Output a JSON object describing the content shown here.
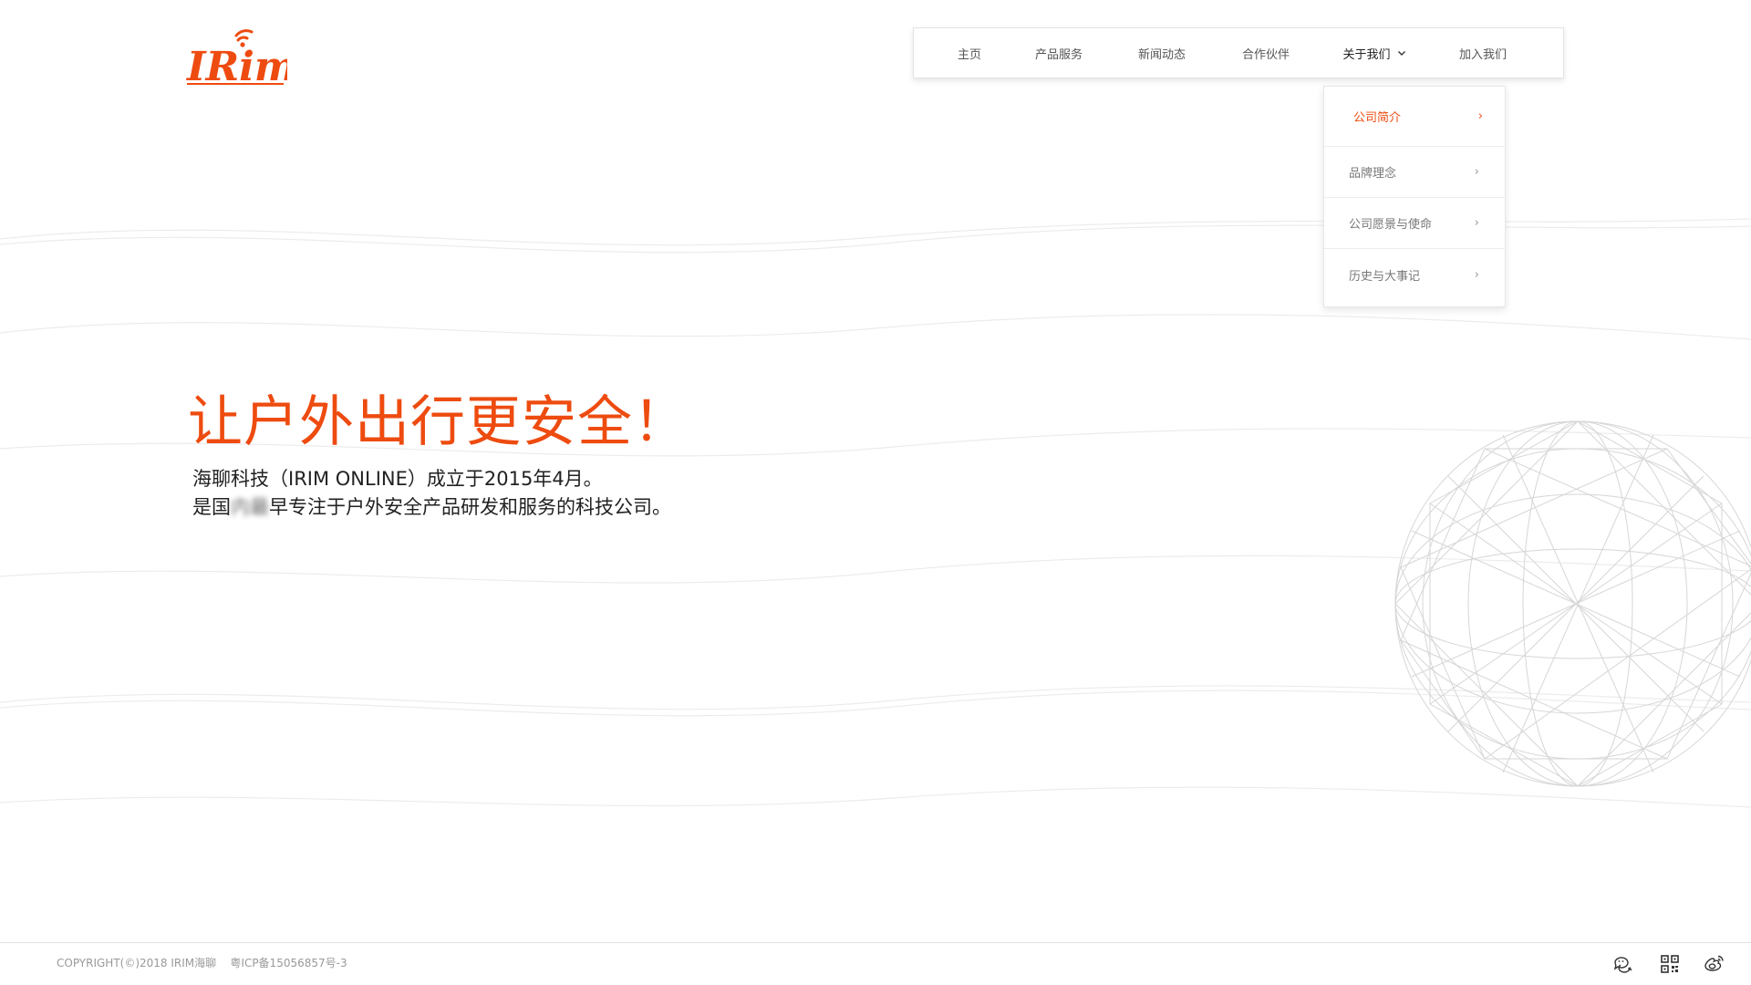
{
  "brand": {
    "logo_text": "IRim",
    "accent": "#ee4b10"
  },
  "nav": {
    "items": [
      {
        "label": "主页"
      },
      {
        "label": "产品服务"
      },
      {
        "label": "新闻动态"
      },
      {
        "label": "合作伙伴"
      },
      {
        "label": "关于我们",
        "has_dropdown": true,
        "icon": "chevron-down-icon"
      },
      {
        "label": "加入我们"
      }
    ]
  },
  "dropdown": {
    "items": [
      {
        "label": "公司简介",
        "arrow": "›",
        "selected": true
      },
      {
        "label": "品牌理念",
        "arrow": "›"
      },
      {
        "label": "公司愿景与使命",
        "arrow": "›"
      },
      {
        "label": "历史与大事记",
        "arrow": "›"
      }
    ]
  },
  "hero": {
    "title": "让户外出行更安全！",
    "line1": "海聊科技（IRIM ONLINE）成立于2015年4月。",
    "line2_prefix": "是国",
    "line2_blurred": "内最",
    "line2_suffix": "早专注于户外安全产品研发和服务的科技公司。"
  },
  "footer": {
    "copyright": "COPYRIGHT(©)2018 IRIM海聊    粤ICP备15056857号-3",
    "icons": [
      "wechat-icon",
      "qr-code-icon",
      "weibo-icon"
    ]
  }
}
